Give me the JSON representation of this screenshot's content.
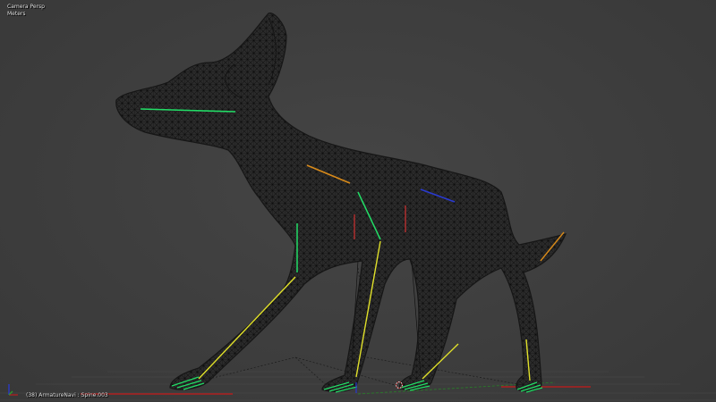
{
  "viewport": {
    "view_name": "Camera Persp",
    "units": "Meters",
    "object_info": "(38) ArmatureNavi : Spine.003"
  },
  "colors": {
    "background": "#3d3d3d",
    "mesh_wire": "#111111",
    "bone_selected": "#22dd66",
    "bone_yellow": "#e0e02a",
    "bone_orange": "#d88a1a",
    "bone_red": "#b83030",
    "bone_blue": "#2a3ad0",
    "grid": "#555555",
    "axis_x": "#b02020",
    "axis_y": "#2a7a2a"
  },
  "icons": {
    "axis_gizmo": "axis-gizmo-icon",
    "cursor": "3d-cursor-icon"
  }
}
